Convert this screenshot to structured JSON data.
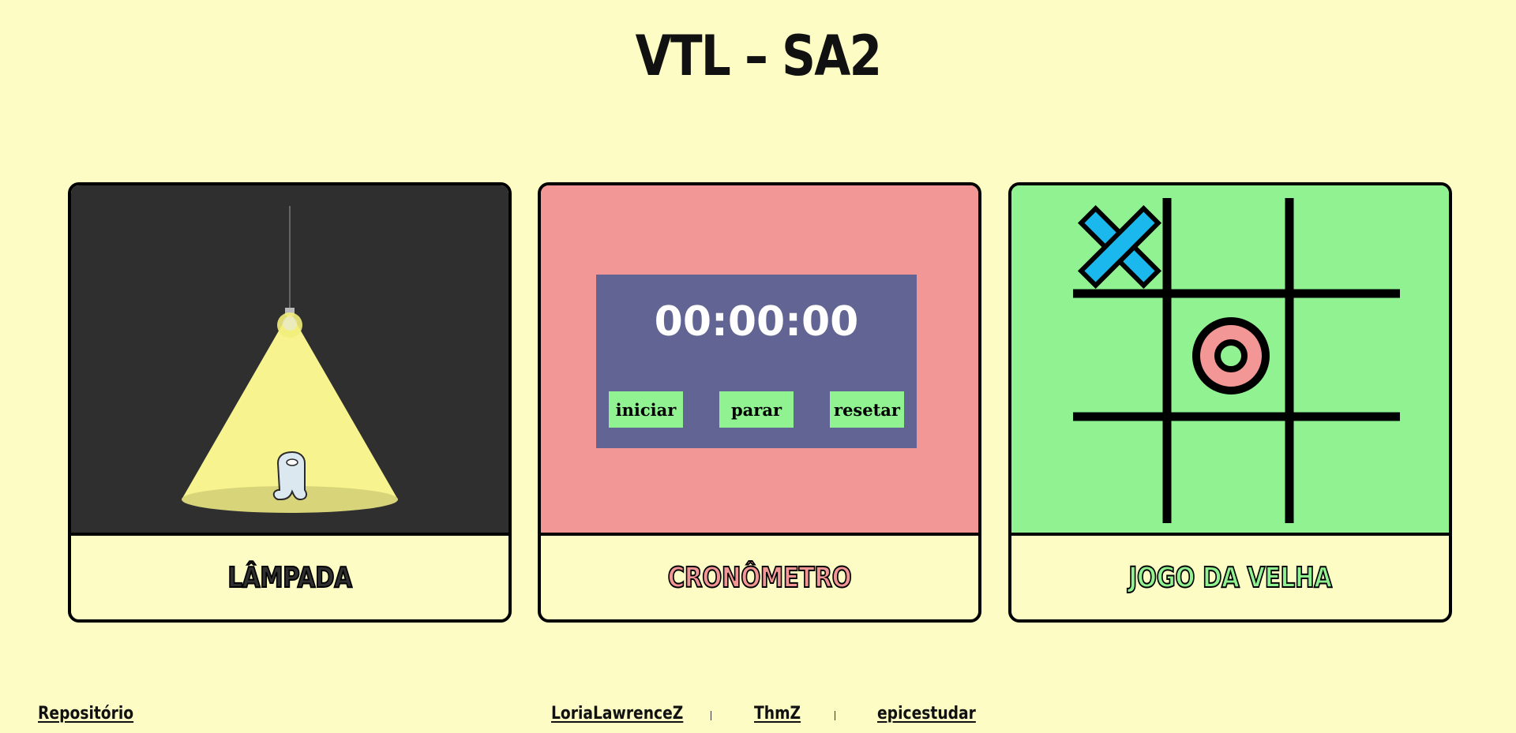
{
  "page": {
    "title": "VTL – SA2"
  },
  "colors": {
    "background": "#fcfcc4",
    "lamp_bg": "#2f2f2f",
    "light_cone": "#f7f38f",
    "chrono_bg": "#f29696",
    "chrono_panel": "#626594",
    "chrono_button": "#91f291",
    "ttt_bg": "#91f291",
    "ttt_x": "#1ab8ec",
    "ttt_o": "#f29696"
  },
  "cards": [
    {
      "label": "LÂMPADA",
      "preview": "lamp-scene"
    },
    {
      "label": "CRONÔMETRO",
      "preview": "stopwatch"
    },
    {
      "label": "JOGO DA VELHA",
      "preview": "tic-tac-toe-board"
    }
  ],
  "stopwatch": {
    "time": "00:00:00",
    "buttons": [
      "iniciar",
      "parar",
      "resetar"
    ]
  },
  "tictactoe": {
    "board": [
      "X",
      "",
      "",
      "",
      "O",
      "",
      "",
      "",
      ""
    ]
  },
  "footer": {
    "repo_label": "Repositório",
    "authors": [
      "LoriaLawrenceZ",
      "ThmZ",
      "epicestudar"
    ]
  }
}
